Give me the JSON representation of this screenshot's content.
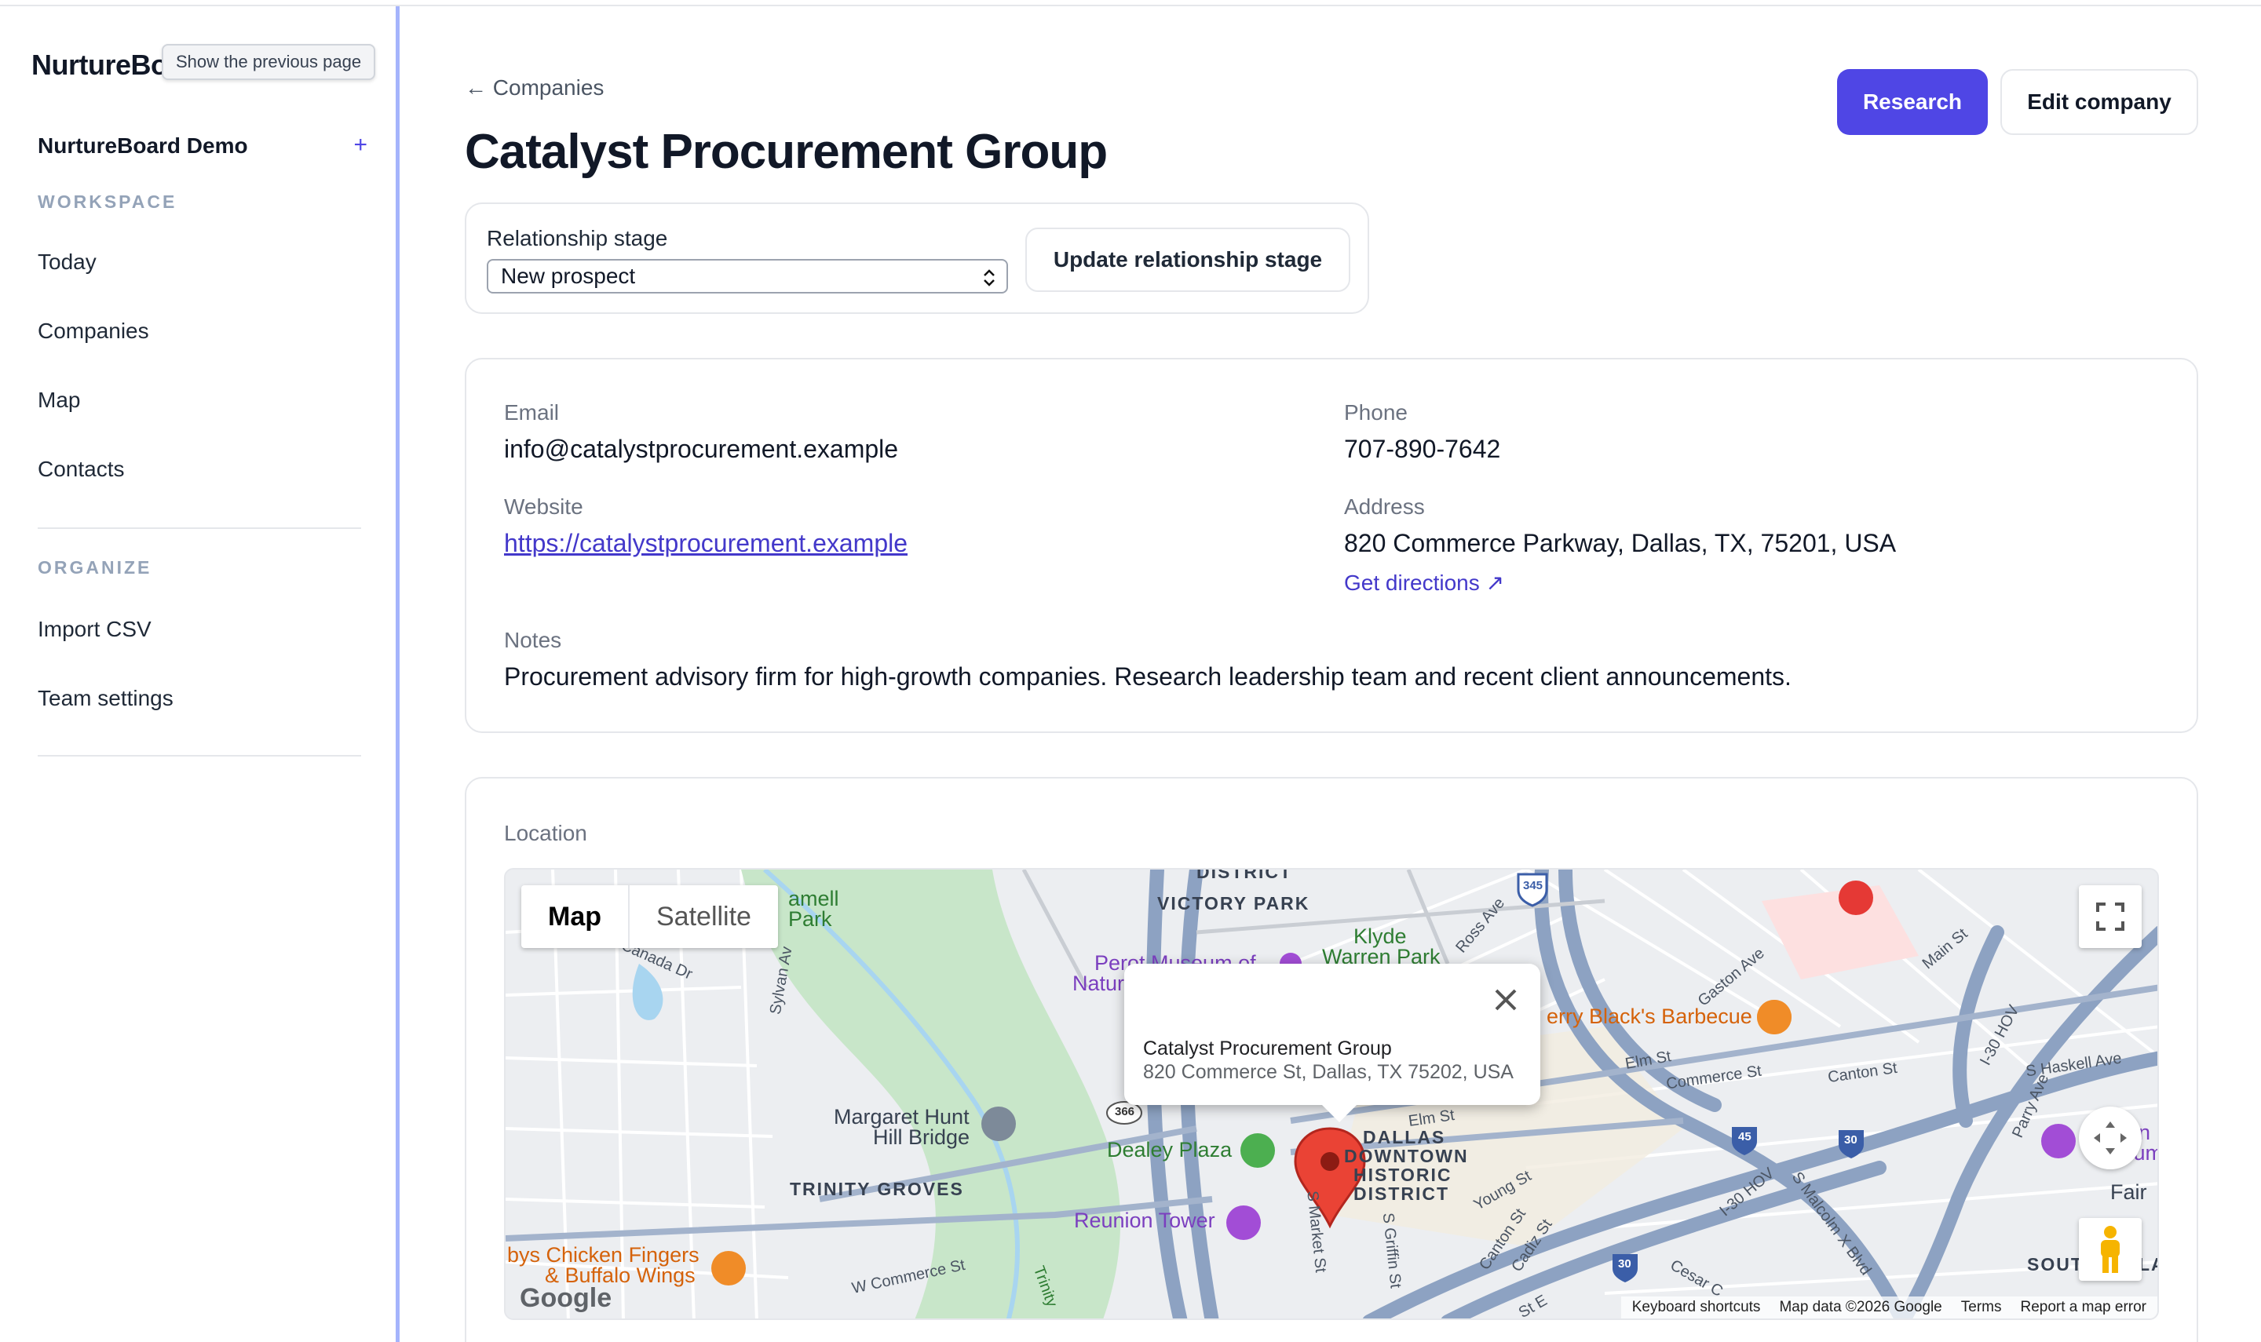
{
  "sidebar": {
    "brand": "NurtureBoard",
    "tooltip": "Show the previous page",
    "workspace_name": "NurtureBoard Demo",
    "workspace_add": "+",
    "section_workspace": "WORKSPACE",
    "section_organize": "ORGANIZE",
    "nav": {
      "today": "Today",
      "companies": "Companies",
      "map": "Map",
      "contacts": "Contacts",
      "import_csv": "Import CSV",
      "team_settings": "Team settings"
    }
  },
  "header": {
    "back_label": "← Companies",
    "title": "Catalyst Procurement Group",
    "research_label": "Research",
    "edit_label": "Edit company"
  },
  "stage": {
    "label": "Relationship stage",
    "selected": "New prospect",
    "chevron": "⌃⌄",
    "update_label": "Update relationship stage"
  },
  "details": {
    "email_label": "Email",
    "email": "info@catalystprocurement.example",
    "phone_label": "Phone",
    "phone": "707-890-7642",
    "website_label": "Website",
    "website": "https://catalystprocurement.example",
    "address_label": "Address",
    "address": "820 Commerce Parkway, Dallas, TX, 75201, USA",
    "directions": "Get directions ↗",
    "notes_label": "Notes",
    "notes": "Procurement advisory firm for high-growth companies. Research leadership team and recent client announcements."
  },
  "location": {
    "label": "Location",
    "map_tab": "Map",
    "satellite_tab": "Satellite",
    "infowindow_title": "Catalyst Procurement Group",
    "infowindow_address": "820 Commerce St, Dallas, TX 75202, USA",
    "footer": {
      "shortcuts": "Keyboard shortcuts",
      "data": "Map data ©2026 Google",
      "terms": "Terms",
      "report": "Report a map error"
    },
    "google": "Google",
    "labels": {
      "district_top": "DISTRICT",
      "victory_park": "VICTORY PARK",
      "klyde_1": "Klyde",
      "klyde_2": "Warren Park",
      "perot_1": "Perot Museum of",
      "perot_2": "Natur",
      "campbell_1": "amell",
      "campbell_2": "Park",
      "canada_dr": "Canada Dr",
      "sylvan_av": "Sylvan Av",
      "ross_ave": "Ross Ave",
      "margaret_1": "Margaret Hunt",
      "margaret_2": "Hill Bridge",
      "dealey": "Dealey Plaza",
      "dallas_1": "DALLAS",
      "dallas_2": "DOWNTOWN",
      "dallas_3": "HISTORIC",
      "dallas_4": "DISTRICT",
      "trinity_groves": "TRINITY GROVES",
      "reunion": "Reunion Tower",
      "chicken_1": "bys Chicken Fingers",
      "chicken_2": "& Buffalo Wings",
      "w_commerce": "W Commerce St",
      "trinity": "Trinity",
      "s_market": "S Market St",
      "s_griffin": "S Griffin St",
      "young_st": "Young St",
      "canton_st": "Canton St",
      "cadiz_st": "Cadiz St",
      "cesar": "Cesar C",
      "st_e": "St E",
      "elm_st": "Elm St",
      "elm_st_2": "Elm St",
      "commerce_st": "Commerce St",
      "canton_st_2": "Canton St",
      "gaston": "Gaston Ave",
      "main_st": "Main St",
      "i30hov": "I-30 HOV",
      "i30hov_2": "I-30 HOV",
      "haskell": "S Haskell Ave",
      "parry": "Parry Ave",
      "malcolm": "S Malcolm X Blvd",
      "ferry": "erry Black's Barbecue",
      "fair": "Fair",
      "south": "SOUT",
      "la": "LA",
      "n_letter": "n",
      "cum": "cum",
      "shield_345": "345",
      "shield_366": "366",
      "shield_45": "45",
      "shield_30a": "30",
      "shield_30b": "30"
    }
  }
}
